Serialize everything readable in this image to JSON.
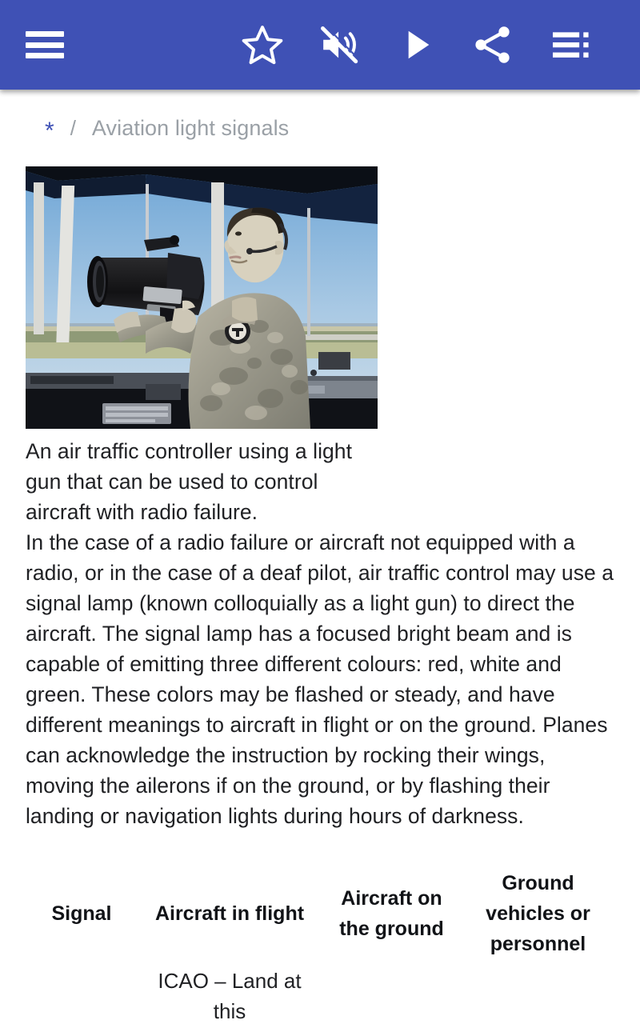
{
  "appbar": {
    "background": "#3f51b5",
    "menu_label": "Menu",
    "actions": [
      {
        "name": "star-icon",
        "label": "Add to favorites"
      },
      {
        "name": "volume-mute-icon",
        "label": "Mute"
      },
      {
        "name": "play-icon",
        "label": "Play"
      },
      {
        "name": "share-icon",
        "label": "Share"
      },
      {
        "name": "contents-list-icon",
        "label": "Contents"
      }
    ]
  },
  "breadcrumb": {
    "home": "*",
    "separator": "/",
    "current": "Aviation light signals",
    "home_color": "#3f51b5",
    "text_color": "#9aa0a6"
  },
  "figure": {
    "alt": "An air traffic controller in a control tower aiming a signal light gun out the window",
    "caption": "An air traffic controller using a light gun that can be used to control aircraft with radio failure."
  },
  "article": {
    "body": "In the case of a radio failure or aircraft not equipped with a radio, or in the case of a deaf pilot, air traffic control may use a signal lamp (known colloquially as a light gun) to direct the aircraft. The signal lamp has a focused bright beam and is capable of emitting three different colours: red, white and green. These colors may be flashed or steady, and have different meanings to aircraft in flight or on the ground. Planes can acknowledge the instruction by rocking their wings, moving the ailerons if on the ground, or by flashing their landing or navigation lights during hours of darkness."
  },
  "table": {
    "headers": [
      "Signal",
      "Aircraft in flight",
      "Aircraft on the ground",
      "Ground vehicles or personnel"
    ],
    "rows": [
      {
        "signal": "",
        "in_flight": "ICAO – Land at this",
        "on_ground": "",
        "ground_vehicles": ""
      }
    ]
  }
}
